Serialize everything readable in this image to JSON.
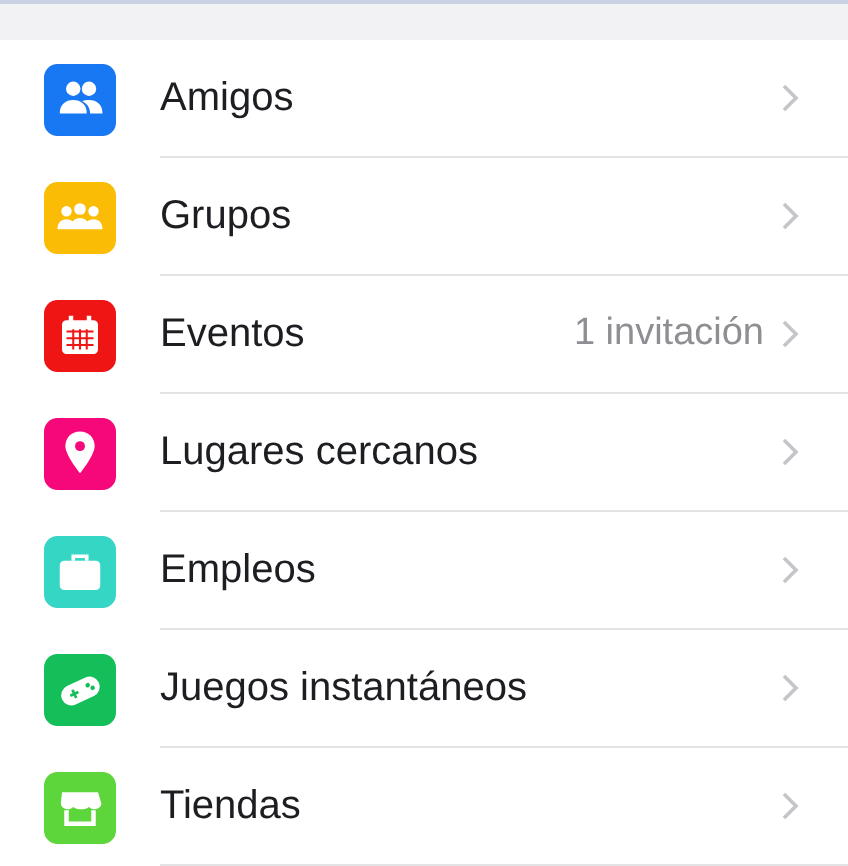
{
  "items": [
    {
      "label": "Amigos",
      "kind": "friends",
      "color": "#1877f2"
    },
    {
      "label": "Grupos",
      "kind": "groups",
      "color": "#fbbc05"
    },
    {
      "label": "Eventos",
      "kind": "calendar",
      "color": "#f01515"
    },
    {
      "label": "Lugares cercanos",
      "kind": "pin",
      "color": "#f7087a"
    },
    {
      "label": "Empleos",
      "kind": "briefcase",
      "color": "#35d6c4"
    },
    {
      "label": "Juegos instantáneos",
      "kind": "gamepad",
      "color": "#14bf5a"
    },
    {
      "label": "Tiendas",
      "kind": "store",
      "color": "#5cd63a"
    }
  ],
  "events_detail": "1 invitación"
}
